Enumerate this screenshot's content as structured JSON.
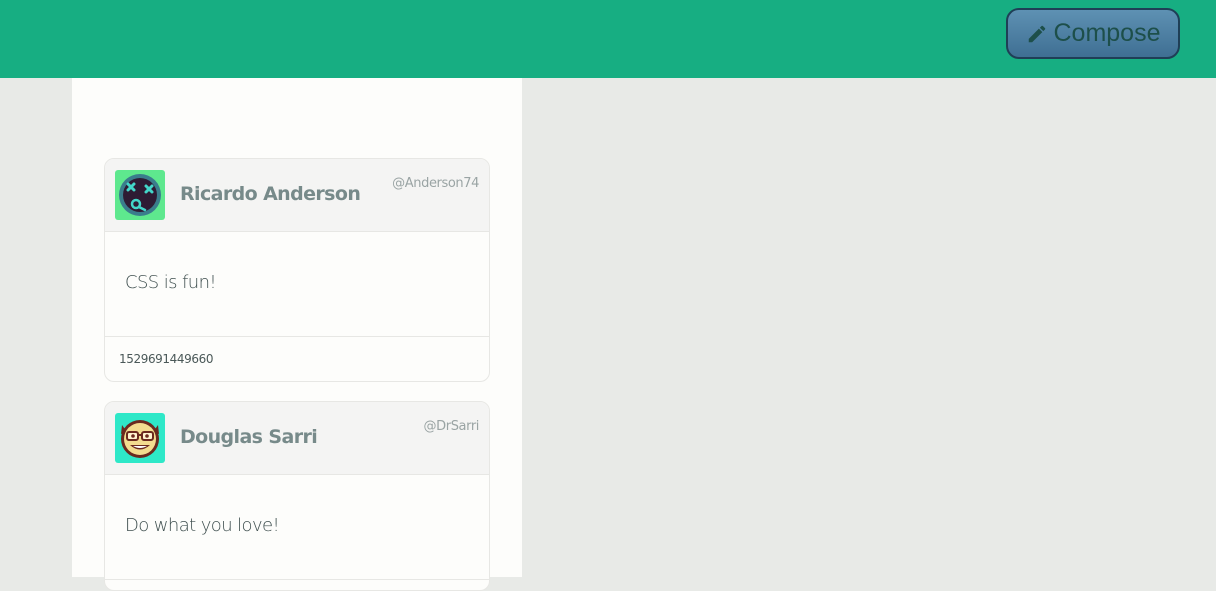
{
  "header": {
    "compose_label": "Compose",
    "compose_icon": "pencil-icon",
    "background_color": "#17ae82"
  },
  "tweets": [
    {
      "name": "Ricardo Anderson",
      "handle": "@Anderson74",
      "text": "CSS is fun!",
      "timestamp": "1529691449660",
      "avatar_icon": "dizzy-face-avatar",
      "avatar_color": "#5ee88e"
    },
    {
      "name": "Douglas Sarri",
      "handle": "@DrSarri",
      "text": "Do what you love!",
      "avatar_icon": "nerd-face-avatar",
      "avatar_color": "#2ee8c8"
    }
  ]
}
